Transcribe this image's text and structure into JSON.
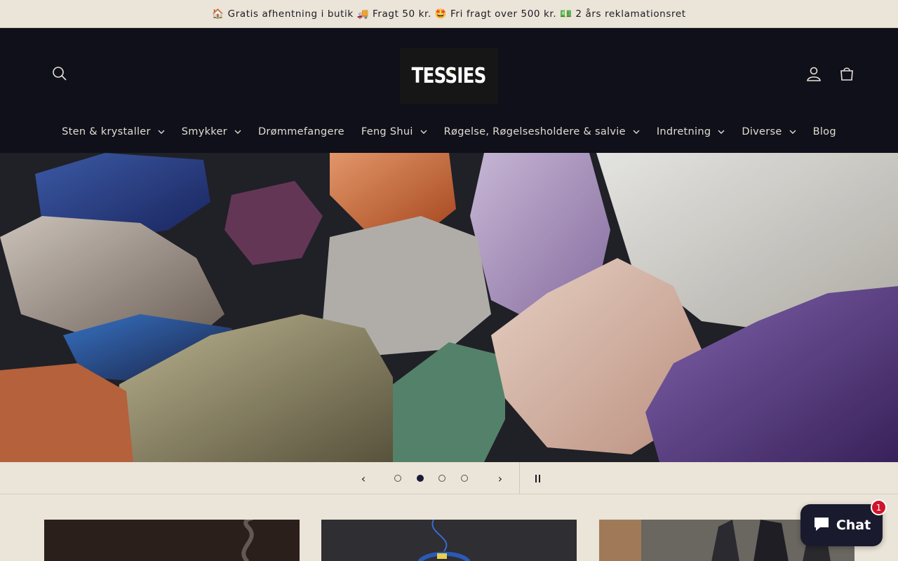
{
  "announcement": {
    "text": "🏠 Gratis afhentning i butik 🚚 Fragt 50 kr. 🤩 Fri fragt over 500 kr. 💵 2 års reklamationsret"
  },
  "header": {
    "logo_text": "TESSIES",
    "icons": {
      "search": "search-icon",
      "account": "user-icon",
      "cart": "bag-icon"
    }
  },
  "nav": {
    "items": [
      {
        "label": "Sten & krystaller",
        "has_dropdown": true
      },
      {
        "label": "Smykker",
        "has_dropdown": true
      },
      {
        "label": "Drømmefangere",
        "has_dropdown": false
      },
      {
        "label": "Feng Shui",
        "has_dropdown": true
      },
      {
        "label": "Røgelse, Røgelsesholdere & salvie",
        "has_dropdown": true
      },
      {
        "label": "Indretning",
        "has_dropdown": true
      },
      {
        "label": "Diverse",
        "has_dropdown": true
      },
      {
        "label": "Blog",
        "has_dropdown": false
      }
    ]
  },
  "slideshow": {
    "slide_count": 4,
    "active_slide": 2,
    "prev_icon": "chevron-left-icon",
    "next_icon": "chevron-right-icon",
    "pause_icon": "pause-icon"
  },
  "chat": {
    "label": "Chat",
    "badge": "1"
  },
  "colors": {
    "header_bg": "#0f101a",
    "page_bg": "#ebe4d8",
    "chat_bg": "#1a1a2e",
    "badge": "#d0142c"
  }
}
